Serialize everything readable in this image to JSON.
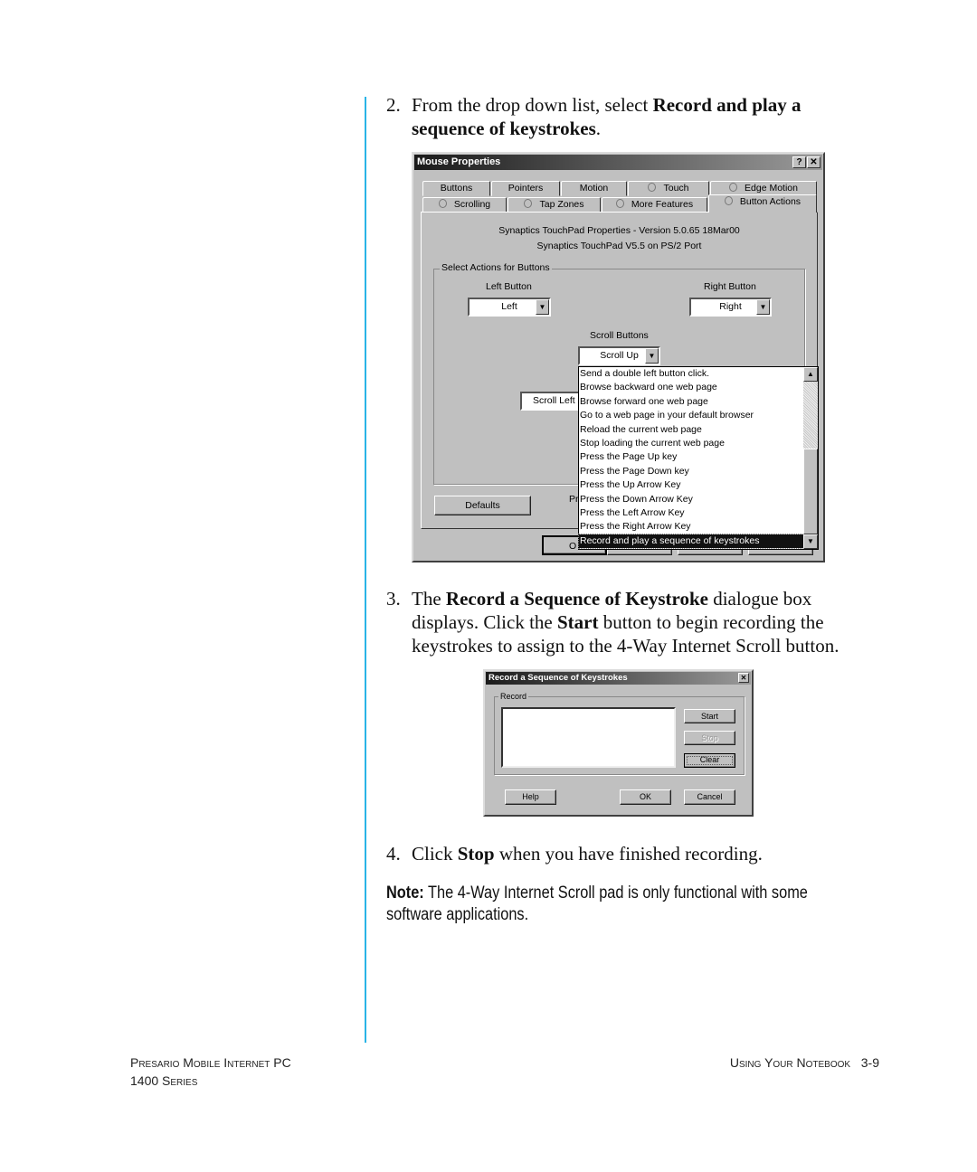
{
  "steps": [
    {
      "num": "2.",
      "pre": "From the drop down list, select ",
      "bold": "Record and play a sequence of keystrokes",
      "post": "."
    },
    {
      "num": "3.",
      "pre": "The ",
      "bold": "Record a Sequence of Keystroke",
      "mid": " dialogue box displays. Click the ",
      "bold2": "Start",
      "post": " button to begin recording the keystrokes to assign to the 4-Way Internet Scroll button."
    },
    {
      "num": "4.",
      "pre": "Click ",
      "bold": "Stop",
      "post": " when you have finished recording."
    }
  ],
  "note": {
    "label": "Note:",
    "text": " The 4-Way Internet Scroll pad is only functional with some software applications."
  },
  "mouse_dialog": {
    "title": "Mouse Properties",
    "help_btn": "?",
    "close_btn": "✕",
    "tabs_row1": [
      "Buttons",
      "Pointers",
      "Motion",
      "Touch",
      "Edge Motion"
    ],
    "tabs_row2": [
      "Scrolling",
      "Tap Zones",
      "More Features",
      "Button Actions"
    ],
    "active_tab": "Button Actions",
    "version_line": "Synaptics TouchPad Properties - Version 5.0.65 18Mar00",
    "port_line": "Synaptics TouchPad V5.5 on PS/2 Port",
    "group_label": "Select Actions for Buttons",
    "left_button_label": "Left Button",
    "left_button_value": "Left",
    "right_button_label": "Right Button",
    "right_button_value": "Right",
    "scroll_buttons_label": "Scroll Buttons",
    "scroll_up_value": "Scroll Up",
    "scroll_left_value": "Scroll Left",
    "partial_label": "Pr",
    "defaults_button": "Defaults",
    "ok_partial": "O",
    "dropdown_options": [
      "Send a double left button click.",
      "Browse backward one web page",
      "Browse forward one web page",
      "Go to a web page in your default browser",
      "Reload the current web page",
      "Stop loading the current web page",
      "Press the Page Up key",
      "Press the Page Down key",
      "Press the Up Arrow Key",
      "Press the Down Arrow Key",
      "Press the Left Arrow Key",
      "Press the Right Arrow Key",
      "Record and play a sequence of keystrokes"
    ],
    "selected_option": "Record and play a sequence of keystrokes"
  },
  "record_dialog": {
    "title": "Record a Sequence of Keystrokes",
    "close_btn": "✕",
    "group_label": "Record",
    "start": "Start",
    "stop": "Stop",
    "clear": "Clear",
    "help": "Help",
    "ok": "OK",
    "cancel": "Cancel"
  },
  "footer": {
    "left_line1": "Presario Mobile Internet PC",
    "left_line2": "1400 Series",
    "right_section": "Using Your Notebook",
    "page_number": "3-9"
  }
}
